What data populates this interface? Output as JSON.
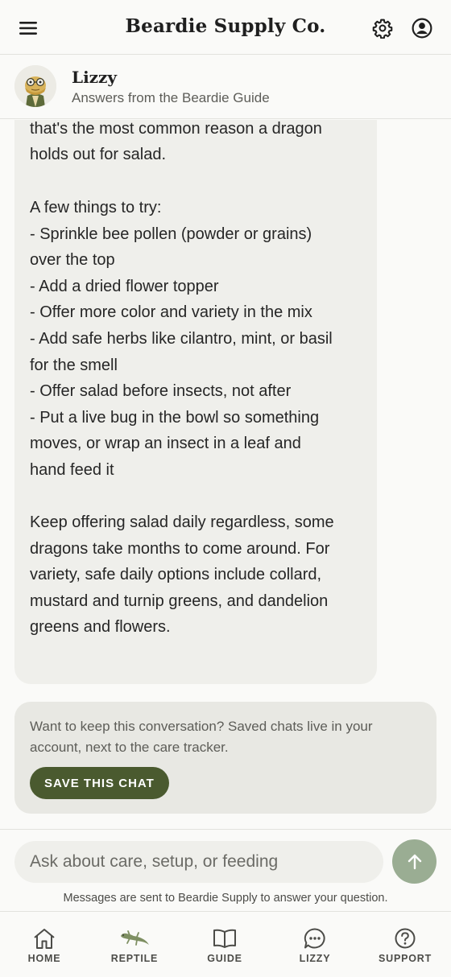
{
  "header": {
    "brand": "Beardie Supply Co.",
    "icons": {
      "menu": "hamburger-icon",
      "settings": "gear-icon",
      "account": "user-circle-icon"
    }
  },
  "agent": {
    "name": "Lizzy",
    "subtitle": "Answers from the Beardie Guide",
    "avatar_icon": "bearded-dragon-avatar"
  },
  "message": {
    "paragraphs": [
      "check she isn't getting too many insects,\nthat's the most common reason a dragon\nholds out for salad.",
      "A few things to try:\n- Sprinkle bee pollen (powder or grains)\nover the top\n- Add a dried flower topper\n- Offer more color and variety in the mix\n- Add safe herbs like cilantro, mint, or basil\nfor the smell\n- Offer salad before insects, not after\n- Put a live bug in the bowl so something\nmoves, or wrap an insect in a leaf and\nhand feed it",
      "Keep offering salad daily regardless, some\ndragons take months to come around. For\nvariety, safe daily options include collard,\nmustard and turnip greens, and dandelion\ngreens and flowers."
    ]
  },
  "save_prompt": {
    "text": "Want to keep this conversation? Saved chats live in your account, next to the care tracker.",
    "button": "SAVE THIS CHAT"
  },
  "composer": {
    "placeholder": "Ask about care, setup, or feeding",
    "value": "",
    "send_icon": "arrow-up-icon",
    "disclaimer": "Messages are sent to Beardie Supply to answer your question."
  },
  "nav": {
    "items": [
      {
        "label": "HOME",
        "icon": "home-icon"
      },
      {
        "label": "REPTILE",
        "icon": "lizard-icon"
      },
      {
        "label": "GUIDE",
        "icon": "book-icon"
      },
      {
        "label": "LIZZY",
        "icon": "chat-bubble-icon"
      },
      {
        "label": "SUPPORT",
        "icon": "help-circle-icon"
      }
    ]
  },
  "colors": {
    "accent": "#4a5a2f",
    "send_button": "#9aad93",
    "bubble": "#efefeb",
    "card": "#e8e8e3",
    "background": "#fafaf8"
  }
}
